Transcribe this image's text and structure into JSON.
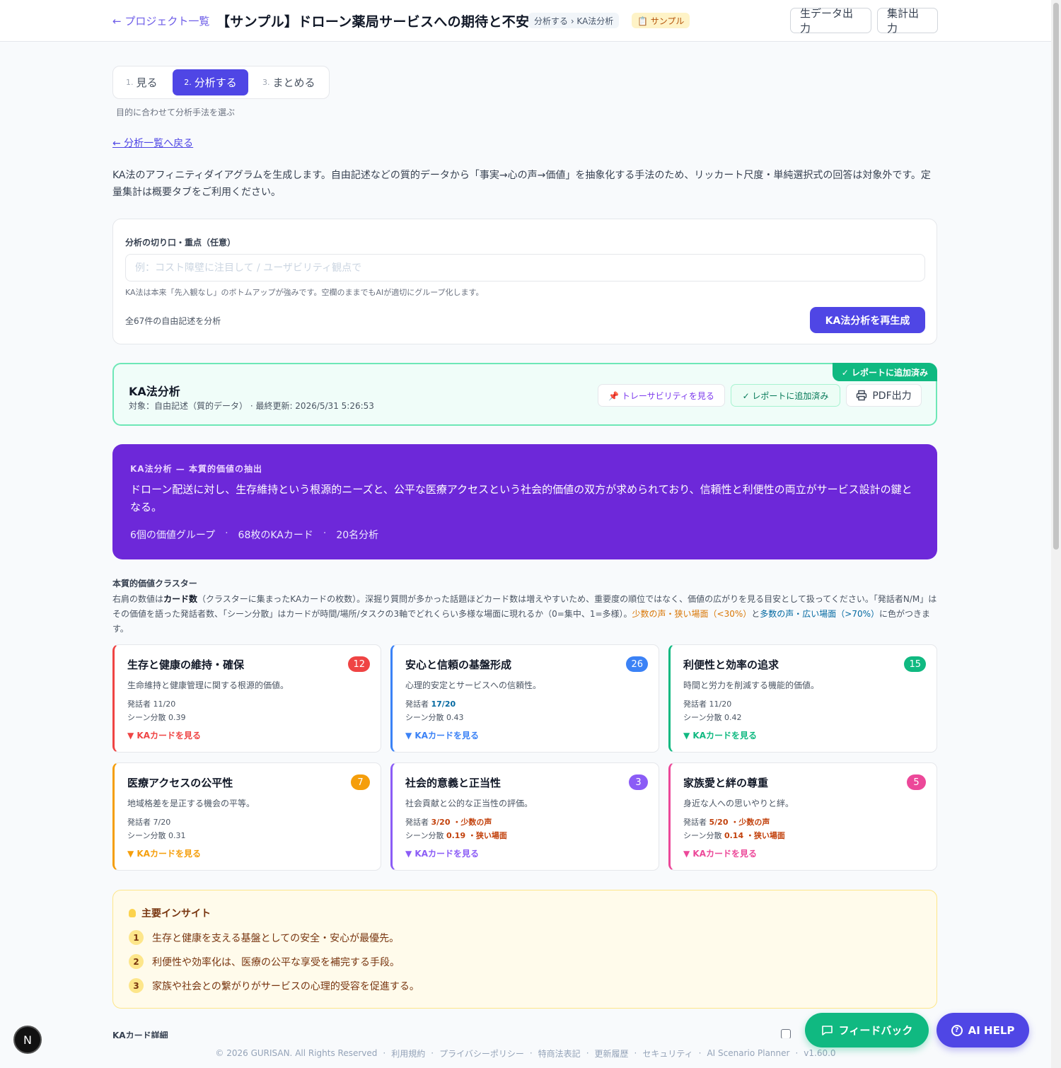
{
  "header": {
    "back_label": "← プロジェクト一覧",
    "title": "【サンプル】ドローン薬局サービスへの期待と不安",
    "breadcrumb": "分析する › KA法分析",
    "sample_badge": "📋 サンプル",
    "raw_export": "生データ出力",
    "summary_export": "集計出力"
  },
  "steps": [
    {
      "num": "1.",
      "label": "見る"
    },
    {
      "num": "2.",
      "label": "分析する"
    },
    {
      "num": "3.",
      "label": "まとめる"
    }
  ],
  "step_hint": "目的に合わせて分析手法を選ぶ",
  "back_analysis": "← 分析一覧へ戻る",
  "intro": "KA法のアフィニティダイアグラムを生成します。自由記述などの質的データから「事実→心の声→価値」を抽象化する手法のため、リッカート尺度・単純選択式の回答は対象外です。定量集計は概要タブをご利用ください。",
  "options": {
    "label": "分析の切り口・重点（任意）",
    "placeholder": "例：コスト障壁に注目して / ユーザビリティ観点で",
    "value": "",
    "note": "KA法は本来「先入観なし」のボトムアップが強みです。空欄のままでもAIが適切にグループ化します。",
    "count": "全67件の自由記述を分析",
    "regen_button": "KA法分析を再生成"
  },
  "result": {
    "ribbon": "✓ レポートに追加済み",
    "title": "KA法分析",
    "meta": "対象：自由記述（質的データ） · 最終更新: 2026/5/31 5:26:53",
    "trace_button": "📌 トレーサビリティを見る",
    "added_button": "✓ レポートに追加済み",
    "pdf_button": "PDF出力"
  },
  "summary": {
    "kicker": "KA法分析 — 本質的価値の抽出",
    "text": "ドローン配送に対し、生存維持という根源的ニーズと、公平な医療アクセスという社会的価値の双方が求められており、信頼性と利便性の両立がサービス設計の鍵となる。",
    "stat_groups": "6個の価値グループ",
    "stat_cards": "68枚のKAカード",
    "stat_people": "20名分析",
    "dot": "·"
  },
  "clusters_section": {
    "title": "本質的価値クラスター",
    "desc_1": "右肩の数値は",
    "desc_bold": "カード数",
    "desc_2": "（クラスターに集まったKAカードの枚数）。深掘り質問が多かった話題ほどカード数は増えやすいため、重要度の順位ではなく、価値の広がりを見る目安として扱ってください。「発話者N/M」はその価値を語った発話者数、「シーン分散」はカードが時間/場所/タスクの3軸でどれくらい多様な場面に現れるか（0=集中、1=多様）。",
    "desc_orange": "少数の声・狭い場面（<30%）",
    "desc_3": "と",
    "desc_blue": "多数の声・広い場面（>70%）",
    "desc_4": "に色がつきます。"
  },
  "clusters": [
    {
      "title": "生存と健康の維持・確保",
      "count": "12",
      "desc": "生命維持と健康管理に関する根源的価値。",
      "speakers_label": "発話者 ",
      "speakers": "11/20",
      "speakers_tag": "",
      "scene_label": "シーン分散 ",
      "scene": "0.39",
      "scene_tag": "",
      "link": "▼ KAカードを見る",
      "color": "#ef4444"
    },
    {
      "title": "安心と信頼の基盤形成",
      "count": "26",
      "desc": "心理的安定とサービスへの信頼性。",
      "speakers_label": "発話者 ",
      "speakers": "17/20",
      "speakers_tag": "",
      "scene_label": "シーン分散 ",
      "scene": "0.43",
      "scene_tag": "",
      "link": "▼ KAカードを見る",
      "color": "#3b82f6"
    },
    {
      "title": "利便性と効率の追求",
      "count": "15",
      "desc": "時間と労力を削減する機能的価値。",
      "speakers_label": "発話者 ",
      "speakers": "11/20",
      "speakers_tag": "",
      "scene_label": "シーン分散 ",
      "scene": "0.42",
      "scene_tag": "",
      "link": "▼ KAカードを見る",
      "color": "#10b981"
    },
    {
      "title": "医療アクセスの公平性",
      "count": "7",
      "desc": "地域格差を是正する機会の平等。",
      "speakers_label": "発話者 ",
      "speakers": "7/20",
      "speakers_tag": "",
      "scene_label": "シーン分散 ",
      "scene": "0.31",
      "scene_tag": "",
      "link": "▼ KAカードを見る",
      "color": "#f59e0b"
    },
    {
      "title": "社会的意義と正当性",
      "count": "3",
      "desc": "社会貢献と公的な正当性の評価。",
      "speakers_label": "発話者 ",
      "speakers": "3/20",
      "speakers_tag": " ・少数の声",
      "scene_label": "シーン分散 ",
      "scene": "0.19",
      "scene_tag": " ・狭い場面",
      "link": "▼ KAカードを見る",
      "color": "#8b5cf6"
    },
    {
      "title": "家族愛と絆の尊重",
      "count": "5",
      "desc": "身近な人への思いやりと絆。",
      "speakers_label": "発話者 ",
      "speakers": "5/20",
      "speakers_tag": " ・少数の声",
      "scene_label": "シーン分散 ",
      "scene": "0.14",
      "scene_tag": " ・狭い場面",
      "link": "▼ KAカードを見る",
      "color": "#ec4899"
    }
  ],
  "insights": {
    "title": "主要インサイト",
    "items": [
      {
        "num": "1",
        "text": "生存と健康を支える基盤としての安全・安心が最優先。"
      },
      {
        "num": "2",
        "text": "利便性や効率化は、医療の公平な享受を補完する手段。"
      },
      {
        "num": "3",
        "text": "家族や社会との繋がりがサービスの心理的受容を促進する。"
      }
    ]
  },
  "cards_title": "KAカード詳細",
  "footer": {
    "copyright": "© 2026 GURISAN. All Rights Reserved",
    "terms": "利用規約",
    "privacy": "プライバシーポリシー",
    "legal": "特商法表記",
    "changelog": "更新履歴",
    "security": "セキュリティ",
    "product": "AI Scenario Planner",
    "version": "v1.60.0",
    "sep": "·"
  },
  "fab": {
    "feedback": "フィードバック",
    "help": "AI HELP",
    "n_badge": "N"
  }
}
